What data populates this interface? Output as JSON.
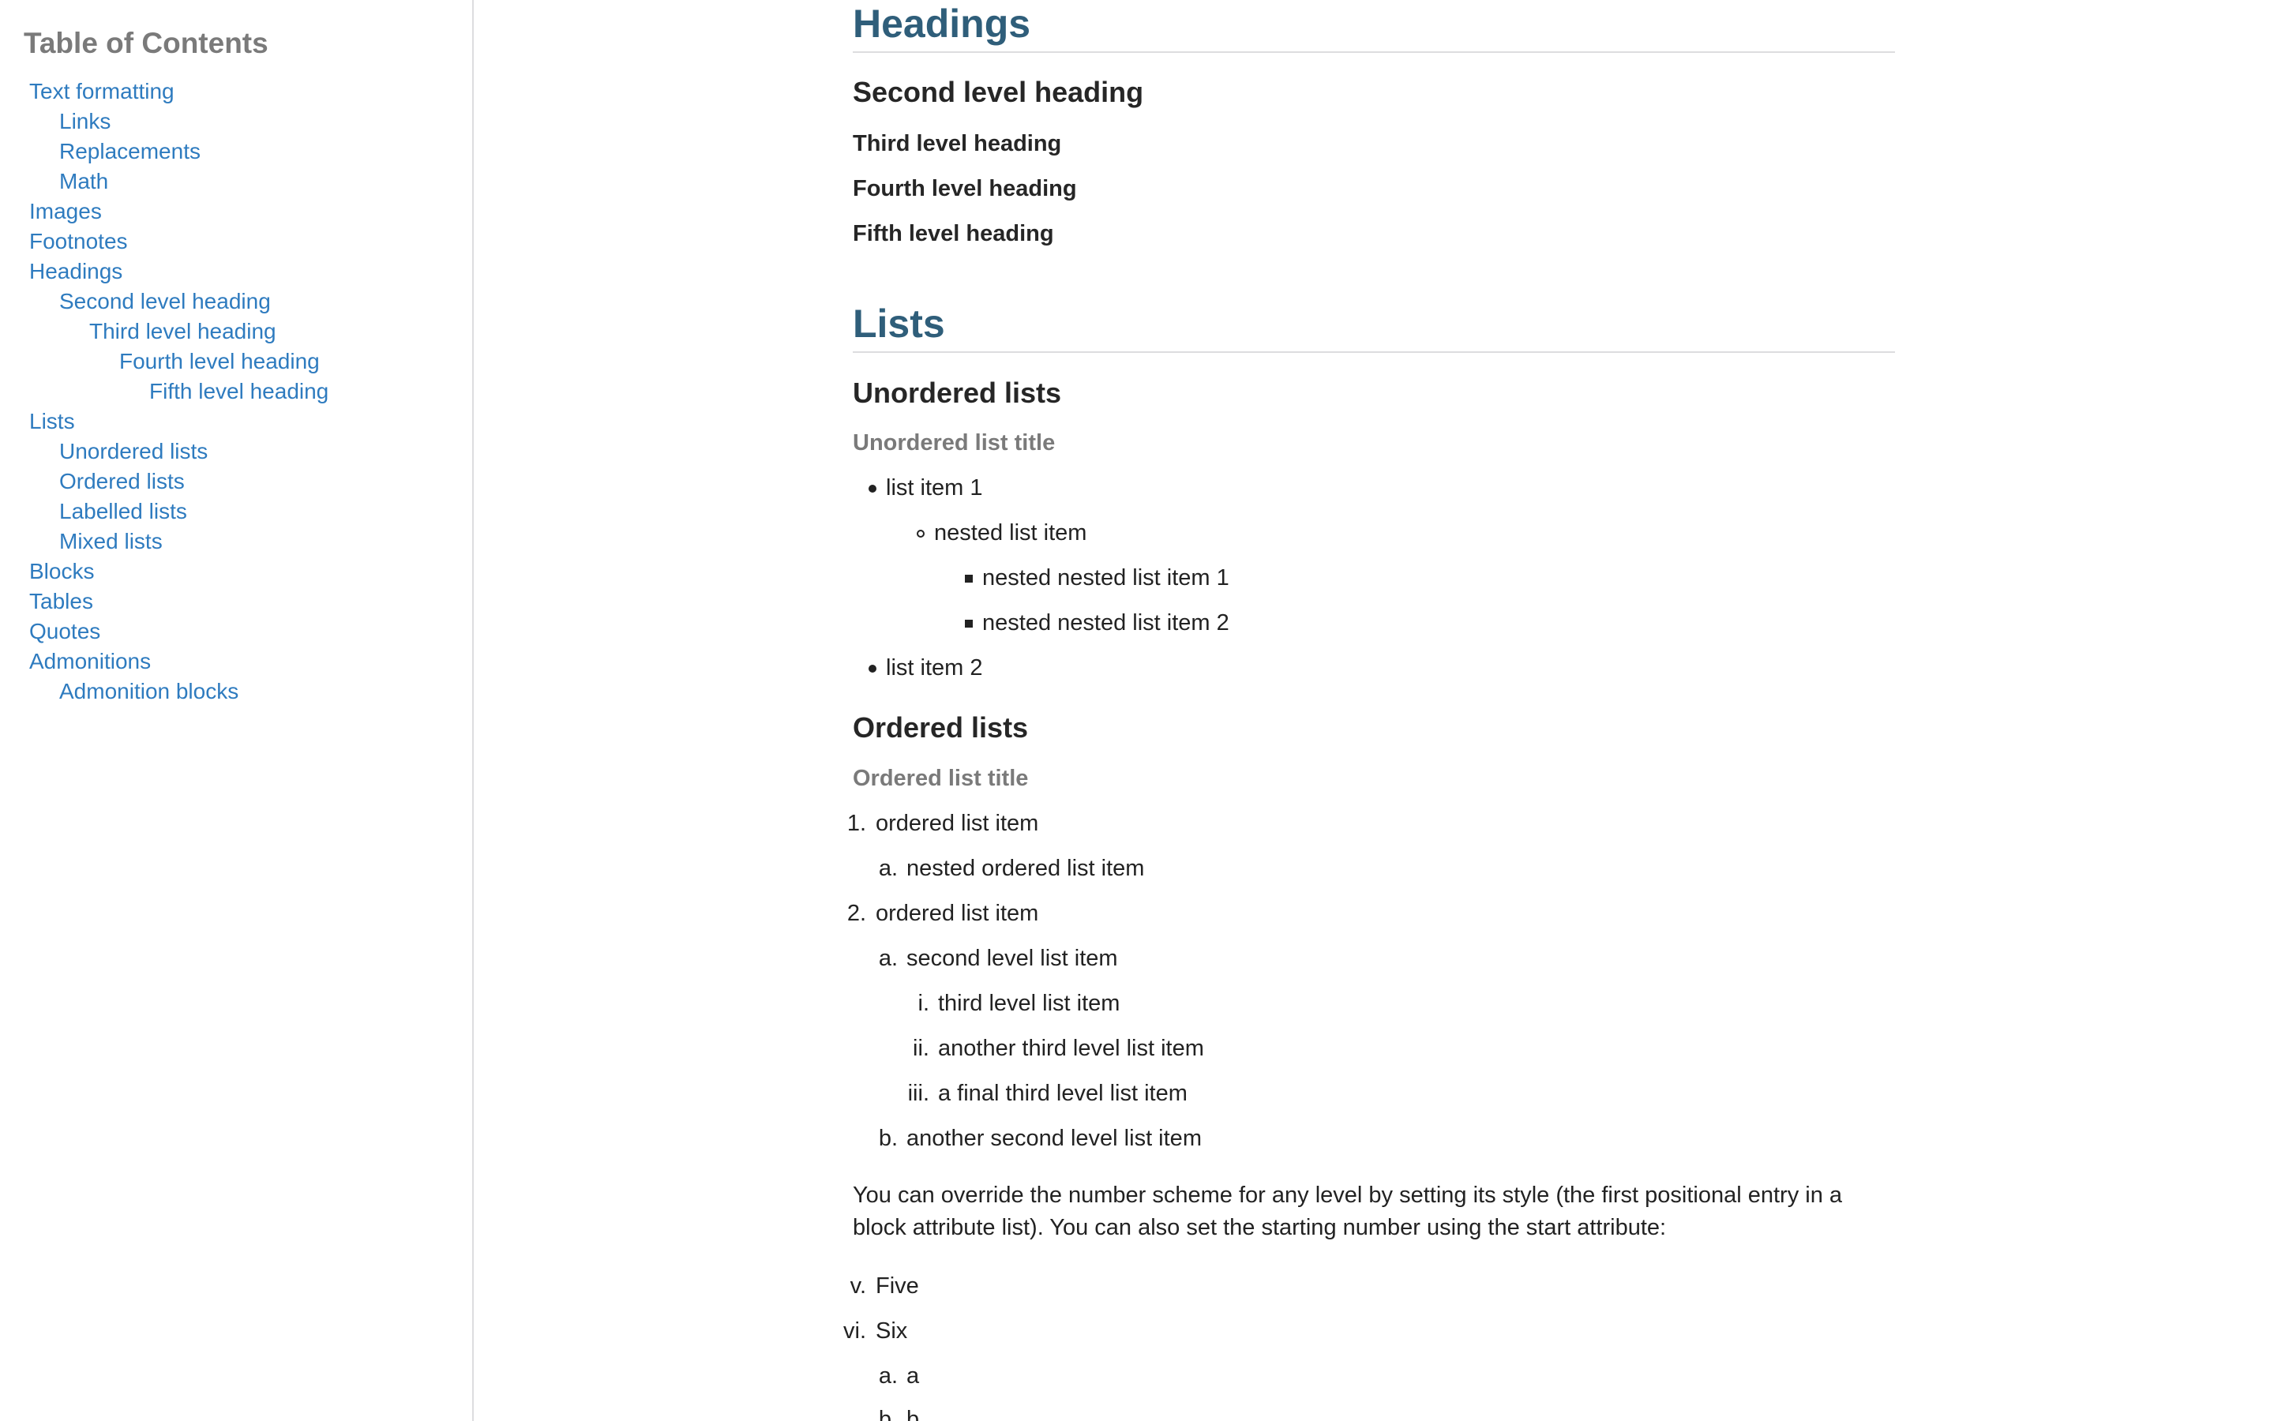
{
  "toc": {
    "title": "Table of Contents",
    "items": [
      {
        "label": "Text formatting",
        "level": 1
      },
      {
        "label": "Links",
        "level": 2
      },
      {
        "label": "Replacements",
        "level": 2
      },
      {
        "label": "Math",
        "level": 2
      },
      {
        "label": "Images",
        "level": 1
      },
      {
        "label": "Footnotes",
        "level": 1
      },
      {
        "label": "Headings",
        "level": 1
      },
      {
        "label": "Second level heading",
        "level": 2
      },
      {
        "label": "Third level heading",
        "level": 3
      },
      {
        "label": "Fourth level heading",
        "level": 4
      },
      {
        "label": "Fifth level heading",
        "level": 5
      },
      {
        "label": "Lists",
        "level": 1
      },
      {
        "label": "Unordered lists",
        "level": 2
      },
      {
        "label": "Ordered lists",
        "level": 2
      },
      {
        "label": "Labelled lists",
        "level": 2
      },
      {
        "label": "Mixed lists",
        "level": 2
      },
      {
        "label": "Blocks",
        "level": 1
      },
      {
        "label": "Tables",
        "level": 1
      },
      {
        "label": "Quotes",
        "level": 1
      },
      {
        "label": "Admonitions",
        "level": 1
      },
      {
        "label": "Admonition blocks",
        "level": 2
      }
    ]
  },
  "headings_section": {
    "title": "Headings",
    "second": "Second level heading",
    "third": "Third level heading",
    "fourth": "Fourth level heading",
    "fifth": "Fifth level heading"
  },
  "lists_section": {
    "title": "Lists",
    "unordered": {
      "heading": "Unordered lists",
      "list_title": "Unordered list title",
      "items": [
        "list item 1",
        "nested list item",
        "nested nested list item 1",
        "nested nested list item 2",
        "list item 2"
      ]
    },
    "ordered": {
      "heading": "Ordered lists",
      "list_title": "Ordered list title",
      "items": [
        {
          "marker": "1.",
          "text": "ordered list item"
        },
        {
          "marker": "a.",
          "text": "nested ordered list item"
        },
        {
          "marker": "2.",
          "text": "ordered list item"
        },
        {
          "marker": "a.",
          "text": "second level list item"
        },
        {
          "marker": "i.",
          "text": "third level list item"
        },
        {
          "marker": "ii.",
          "text": "another third level list item"
        },
        {
          "marker": "iii.",
          "text": "a final third level list item"
        },
        {
          "marker": "b.",
          "text": "another second level list item"
        }
      ],
      "paragraph": "You can override the number scheme for any level by setting its style (the first positional entry in a block attribute list). You can also set the starting number using the start attribute:",
      "custom_items": [
        {
          "marker": "v.",
          "text": "Five"
        },
        {
          "marker": "vi.",
          "text": "Six"
        },
        {
          "marker": "a.",
          "text": "a"
        },
        {
          "marker": "b.",
          "text": "b"
        }
      ]
    }
  }
}
